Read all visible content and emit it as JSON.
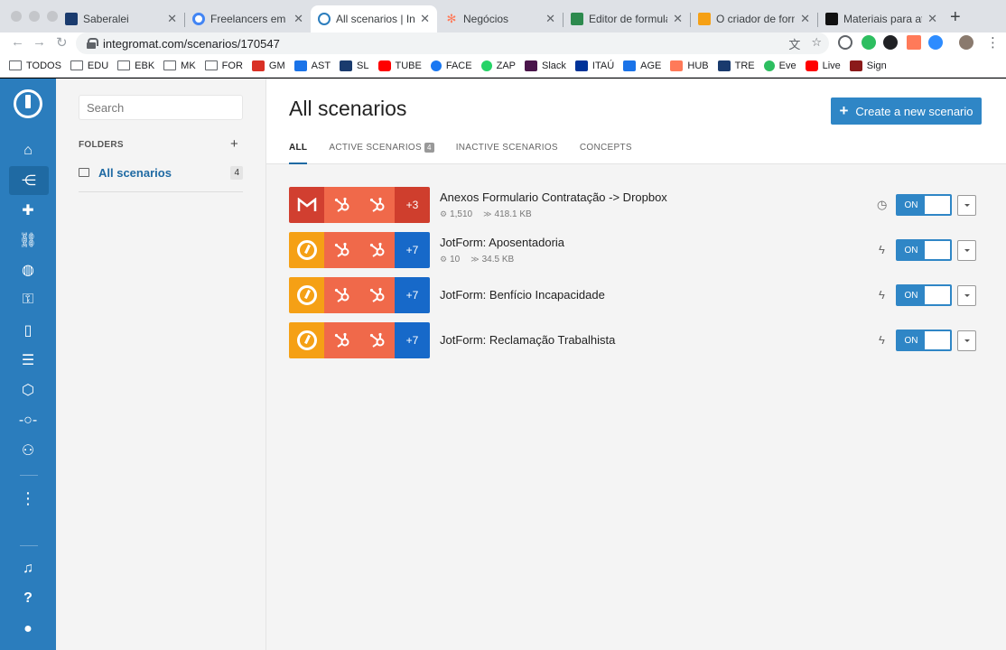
{
  "browser": {
    "tabs": [
      {
        "title": "Saberalei",
        "color": "#1a3b6e"
      },
      {
        "title": "Freelancers em web",
        "color": "#4285f4"
      },
      {
        "title": "All scenarios | Integr",
        "color": "#2b7dbd"
      },
      {
        "title": "Negócios",
        "color": "#ff7a59"
      },
      {
        "title": "Editor de formulário",
        "color": "#2d8a4e"
      },
      {
        "title": "O criador de formulá",
        "color": "#f5a015"
      },
      {
        "title": "Materiais para atend",
        "color": "#111111"
      }
    ],
    "url": "integromat.com/scenarios/170547",
    "bookmarks": [
      {
        "label": "TODOS",
        "icon": "folder-icon"
      },
      {
        "label": "EDU",
        "icon": "folder-icon"
      },
      {
        "label": "EBK",
        "icon": "folder-icon"
      },
      {
        "label": "MK",
        "icon": "folder-icon"
      },
      {
        "label": "FOR",
        "icon": "folder-icon"
      },
      {
        "label": "GM",
        "icon": "gmail-icon",
        "color": "#d93025"
      },
      {
        "label": "AST",
        "icon": "ast-icon",
        "color": "#1a73e8"
      },
      {
        "label": "SL",
        "icon": "sl-icon",
        "color": "#1a3b6e"
      },
      {
        "label": "TUBE",
        "icon": "youtube-icon",
        "color": "#ff0000"
      },
      {
        "label": "FACE",
        "icon": "facebook-icon",
        "color": "#1877f2"
      },
      {
        "label": "ZAP",
        "icon": "whatsapp-icon",
        "color": "#25d366"
      },
      {
        "label": "Slack",
        "icon": "slack-icon",
        "color": "#4a154b"
      },
      {
        "label": "ITAÚ",
        "icon": "itau-icon",
        "color": "#003399"
      },
      {
        "label": "AGE",
        "icon": "calendar-icon",
        "color": "#1a73e8"
      },
      {
        "label": "HUB",
        "icon": "hubspot-icon",
        "color": "#ff7a59"
      },
      {
        "label": "TRE",
        "icon": "tre-icon",
        "color": "#1a3b6e"
      },
      {
        "label": "Eve",
        "icon": "evernote-icon",
        "color": "#2dbe60"
      },
      {
        "label": "Live",
        "icon": "youtube-icon",
        "color": "#ff0000"
      },
      {
        "label": "Sign",
        "icon": "sign-icon",
        "color": "#8b1a1a"
      }
    ]
  },
  "sidebar": {
    "search_placeholder": "Search",
    "folders_header": "FOLDERS",
    "folders_add": "+",
    "folders": [
      {
        "label": "All scenarios",
        "count": "4"
      }
    ]
  },
  "main": {
    "title": "All scenarios",
    "create_label": "Create a new scenario",
    "tabs": [
      {
        "label": "ALL",
        "badge": ""
      },
      {
        "label": "ACTIVE SCENARIOS",
        "badge": "4"
      },
      {
        "label": "INACTIVE SCENARIOS",
        "badge": ""
      },
      {
        "label": "CONCEPTS",
        "badge": ""
      }
    ]
  },
  "scenarios": [
    {
      "name": "Anexos Formulario Contratação -> Dropbox",
      "operations": "1,510",
      "transfer": "418.1 KB",
      "first_module": "gmail",
      "more": "+3",
      "schedule_icon": "clock-icon",
      "status": "ON"
    },
    {
      "name": "JotForm: Aposentadoria",
      "operations": "10",
      "transfer": "34.5 KB",
      "first_module": "jotform",
      "more": "+7",
      "schedule_icon": "bolt-icon",
      "status": "ON"
    },
    {
      "name": "JotForm: Benfício Incapacidade",
      "operations": "",
      "transfer": "",
      "first_module": "jotform",
      "more": "+7",
      "schedule_icon": "bolt-icon",
      "status": "ON"
    },
    {
      "name": "JotForm: Reclamação Trabalhista",
      "operations": "",
      "transfer": "",
      "first_module": "jotform",
      "more": "+7",
      "schedule_icon": "bolt-icon",
      "status": "ON"
    }
  ],
  "colors": {
    "brand": "#2b7dbd",
    "accent": "#2f86c6",
    "gmail": "#d13f30",
    "jotform": "#f5a015",
    "hubspot": "#f0694a",
    "more_red": "#cf3e2d",
    "more_blue": "#1769c9"
  }
}
